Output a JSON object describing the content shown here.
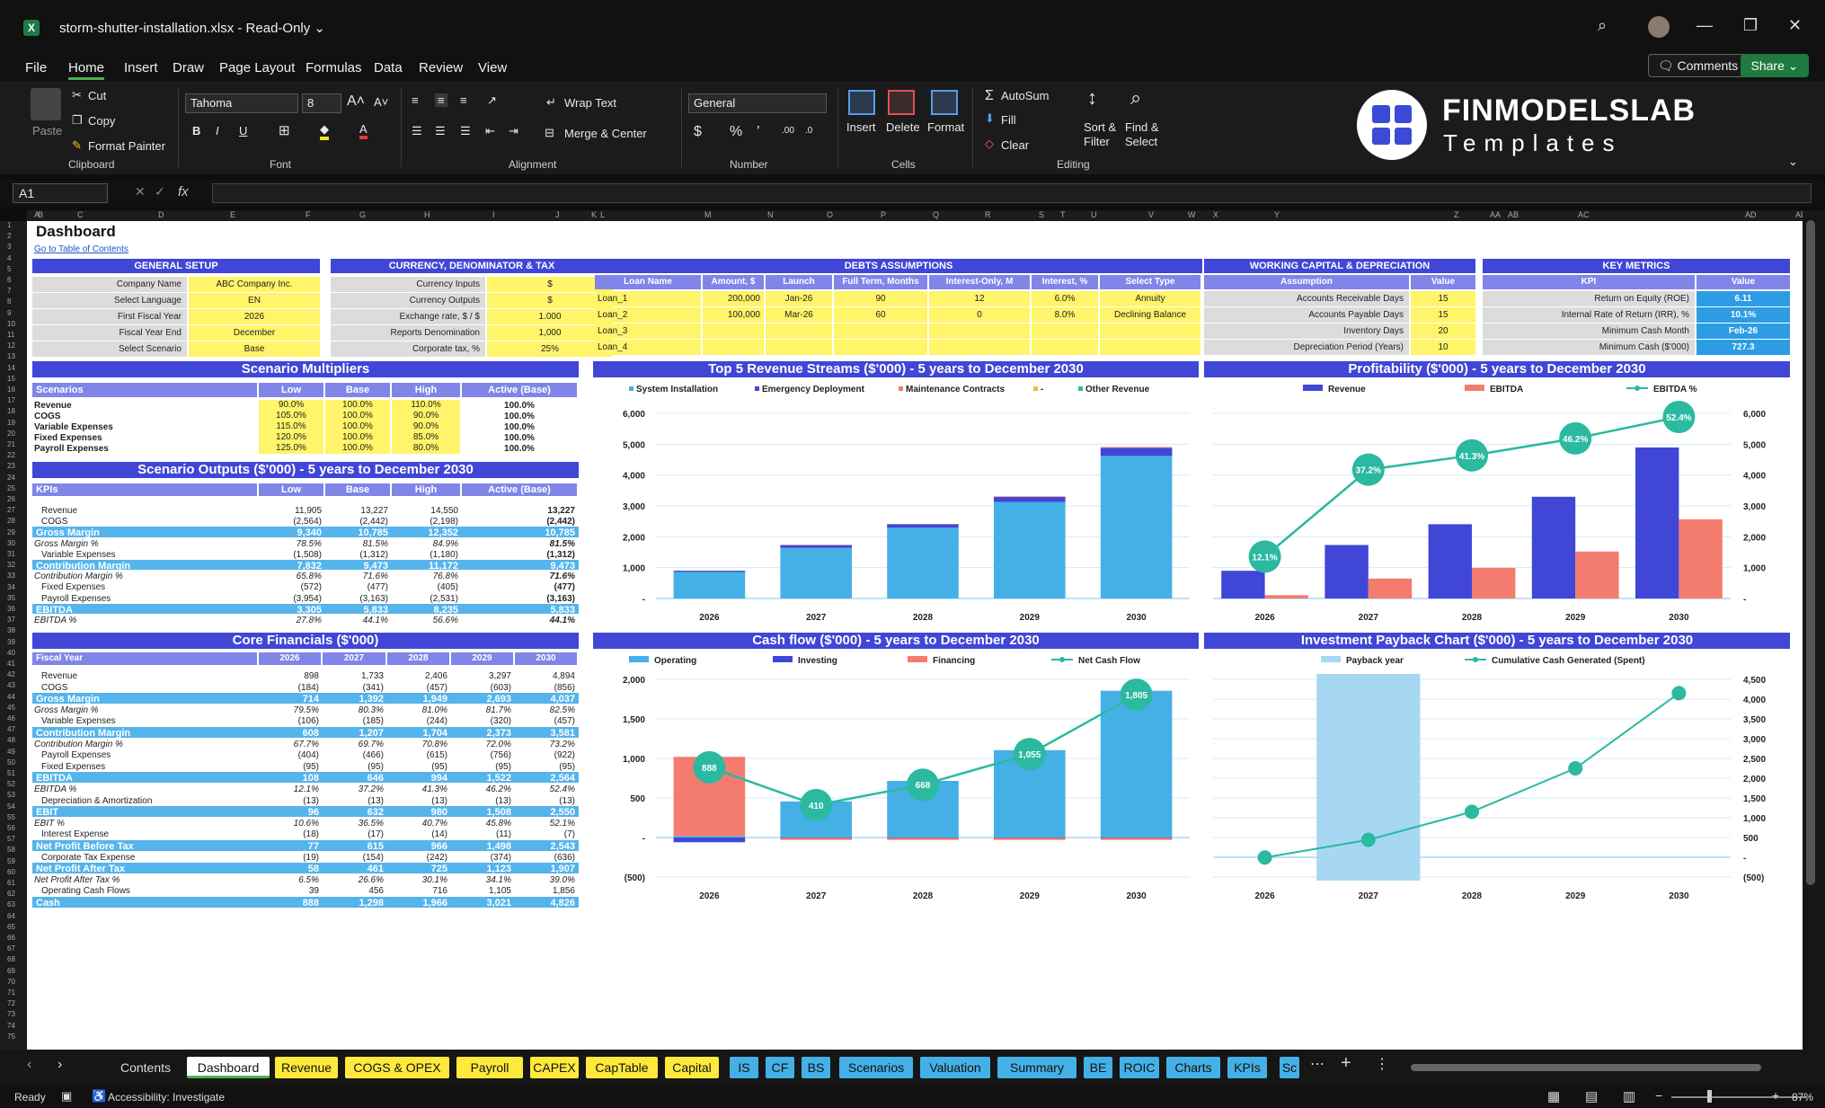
{
  "window": {
    "title": "storm-shutter-installation.xlsx  -  Read-Only ⌄",
    "app_icon": "X"
  },
  "menu": [
    "File",
    "Home",
    "Insert",
    "Draw",
    "Page Layout",
    "Formulas",
    "Data",
    "Review",
    "View"
  ],
  "menu_active": "Home",
  "buttons": {
    "comments": "🗨 Comments",
    "share": "Share ⌄"
  },
  "ribbon": {
    "paste": "Paste",
    "cut": "Cut",
    "copy": "Copy",
    "format_painter": "Format Painter",
    "font_name": "Tahoma",
    "font_size": "8",
    "wrap_text": "Wrap Text",
    "merge_center": "Merge & Center",
    "number_format": "General",
    "insert": "Insert",
    "delete": "Delete",
    "format": "Format",
    "autosum": "AutoSum",
    "fill": "Fill",
    "clear": "Clear",
    "sort_filter": "Sort & Filter",
    "find_select": "Find & Select",
    "groups": [
      "Clipboard",
      "Font",
      "Alignment",
      "Number",
      "Cells",
      "Editing"
    ]
  },
  "logo": {
    "line1": "FINMODELSLAB",
    "line2": "Templates"
  },
  "formula_bar": {
    "name_box": "A1",
    "fx": "fx"
  },
  "columns": [
    "A",
    "B",
    "C",
    "D",
    "E",
    "F",
    "G",
    "H",
    "I",
    "J",
    "K",
    "L",
    "M",
    "N",
    "O",
    "P",
    "Q",
    "R",
    "S",
    "T",
    "U",
    "V",
    "W",
    "X",
    "Y",
    "Z",
    "AA",
    "AB",
    "AC",
    "AD",
    "AE"
  ],
  "dashboard": {
    "title": "Dashboard",
    "link": "Go to Table of Contents",
    "general_setup": {
      "title": "GENERAL SETUP",
      "rows": [
        [
          "Company Name",
          "ABC Company Inc."
        ],
        [
          "Select Language",
          "EN"
        ],
        [
          "First Fiscal Year",
          "2026"
        ],
        [
          "Fiscal Year End",
          "December"
        ],
        [
          "Select Scenario",
          "Base"
        ]
      ]
    },
    "currency": {
      "title": "CURRENCY, DENOMINATOR & TAX",
      "rows": [
        [
          "Currency Inputs",
          "$"
        ],
        [
          "Currency Outputs",
          "$"
        ],
        [
          "Exchange rate, $ / $",
          "1.000"
        ],
        [
          "Reports Denomination",
          "1,000"
        ],
        [
          "Corporate tax, %",
          "25%"
        ]
      ]
    },
    "debts": {
      "title": "DEBTS ASSUMPTIONS",
      "headers": [
        "Loan Name",
        "Amount, $",
        "Launch",
        "Full Term, Months",
        "Interest-Only, M",
        "Interest, %",
        "Select Type"
      ],
      "rows": [
        [
          "Loan_1",
          "200,000",
          "Jan-26",
          "90",
          "12",
          "6.0%",
          "Annuity"
        ],
        [
          "Loan_2",
          "100,000",
          "Mar-26",
          "60",
          "0",
          "8.0%",
          "Declining Balance"
        ],
        [
          "Loan_3",
          "",
          "",
          "",
          "",
          "",
          ""
        ],
        [
          "Loan_4",
          "",
          "",
          "",
          "",
          "",
          ""
        ]
      ]
    },
    "working_capital": {
      "title": "WORKING CAPITAL & DEPRECIATION",
      "headers": [
        "Assumption",
        "Value"
      ],
      "rows": [
        [
          "Accounts Receivable Days",
          "15"
        ],
        [
          "Accounts Payable Days",
          "15"
        ],
        [
          "Inventory Days",
          "20"
        ],
        [
          "Depreciation Period (Years)",
          "10"
        ]
      ]
    },
    "key_metrics": {
      "title": "KEY METRICS",
      "headers": [
        "KPI",
        "Value"
      ],
      "rows": [
        [
          "Return on Equity (ROE)",
          "6.11"
        ],
        [
          "Internal Rate of Return (IRR), %",
          "10.1%"
        ],
        [
          "Minimum Cash Month",
          "Feb-26"
        ],
        [
          "Minimum Cash ($'000)",
          "727.3"
        ]
      ]
    },
    "scenario_multipliers": {
      "title": "Scenario Multipliers",
      "headers": [
        "Scenarios",
        "Low",
        "Base",
        "High",
        "Active (Base)"
      ],
      "rows": [
        [
          "Revenue",
          "90.0%",
          "100.0%",
          "110.0%",
          "100.0%"
        ],
        [
          "COGS",
          "105.0%",
          "100.0%",
          "90.0%",
          "100.0%"
        ],
        [
          "Variable Expenses",
          "115.0%",
          "100.0%",
          "90.0%",
          "100.0%"
        ],
        [
          "Fixed Expenses",
          "120.0%",
          "100.0%",
          "85.0%",
          "100.0%"
        ],
        [
          "Payroll Expenses",
          "125.0%",
          "100.0%",
          "80.0%",
          "100.0%"
        ]
      ]
    },
    "scenario_outputs": {
      "title": "Scenario Outputs ($'000) - 5 years to December 2030",
      "headers": [
        "KPIs",
        "Low",
        "Base",
        "High",
        "Active (Base)"
      ],
      "rows": [
        [
          "Revenue",
          "11,905",
          "13,227",
          "14,550",
          "13,227",
          "n"
        ],
        [
          "COGS",
          "(2,564)",
          "(2,442)",
          "(2,198)",
          "(2,442)",
          "n"
        ],
        [
          "Gross Margin",
          "9,340",
          "10,785",
          "12,352",
          "10,785",
          "b"
        ],
        [
          "Gross Margin %",
          "78.5%",
          "81.5%",
          "84.9%",
          "81.5%",
          "i"
        ],
        [
          "Variable Expenses",
          "(1,508)",
          "(1,312)",
          "(1,180)",
          "(1,312)",
          "n"
        ],
        [
          "Contribution Margin",
          "7,832",
          "9,473",
          "11,172",
          "9,473",
          "b"
        ],
        [
          "Contribution Margin %",
          "65.8%",
          "71.6%",
          "76.8%",
          "71.6%",
          "i"
        ],
        [
          "Fixed Expenses",
          "(572)",
          "(477)",
          "(405)",
          "(477)",
          "n"
        ],
        [
          "Payroll Expenses",
          "(3,954)",
          "(3,163)",
          "(2,531)",
          "(3,163)",
          "n"
        ],
        [
          "EBITDA",
          "3,305",
          "5,833",
          "8,235",
          "5,833",
          "b"
        ],
        [
          "EBITDA %",
          "27.8%",
          "44.1%",
          "56.6%",
          "44.1%",
          "i"
        ]
      ]
    },
    "core_financials": {
      "title": "Core Financials ($'000)",
      "headers": [
        "Fiscal Year",
        "2026",
        "2027",
        "2028",
        "2029",
        "2030"
      ],
      "rows": [
        [
          "Revenue",
          "898",
          "1,733",
          "2,406",
          "3,297",
          "4,894",
          "n"
        ],
        [
          "COGS",
          "(184)",
          "(341)",
          "(457)",
          "(603)",
          "(856)",
          "n"
        ],
        [
          "Gross Margin",
          "714",
          "1,392",
          "1,949",
          "2,693",
          "4,037",
          "b"
        ],
        [
          "Gross Margin %",
          "79.5%",
          "80.3%",
          "81.0%",
          "81.7%",
          "82.5%",
          "i"
        ],
        [
          "Variable Expenses",
          "(106)",
          "(185)",
          "(244)",
          "(320)",
          "(457)",
          "n"
        ],
        [
          "Contribution Margin",
          "608",
          "1,207",
          "1,704",
          "2,373",
          "3,581",
          "b"
        ],
        [
          "Contribution Margin %",
          "67.7%",
          "69.7%",
          "70.8%",
          "72.0%",
          "73.2%",
          "i"
        ],
        [
          "Payroll Expenses",
          "(404)",
          "(466)",
          "(615)",
          "(756)",
          "(922)",
          "n"
        ],
        [
          "Fixed Expenses",
          "(95)",
          "(95)",
          "(95)",
          "(95)",
          "(95)",
          "n"
        ],
        [
          "EBITDA",
          "108",
          "646",
          "994",
          "1,522",
          "2,564",
          "b"
        ],
        [
          "EBITDA %",
          "12.1%",
          "37.2%",
          "41.3%",
          "46.2%",
          "52.4%",
          "i"
        ],
        [
          "Depreciation & Amortization",
          "(13)",
          "(13)",
          "(13)",
          "(13)",
          "(13)",
          "n"
        ],
        [
          "EBIT",
          "96",
          "632",
          "980",
          "1,508",
          "2,550",
          "b"
        ],
        [
          "EBIT %",
          "10.6%",
          "36.5%",
          "40.7%",
          "45.8%",
          "52.1%",
          "i"
        ],
        [
          "Interest Expense",
          "(18)",
          "(17)",
          "(14)",
          "(11)",
          "(7)",
          "n"
        ],
        [
          "Net Profit Before Tax",
          "77",
          "615",
          "966",
          "1,498",
          "2,543",
          "b"
        ],
        [
          "Corporate Tax Expense",
          "(19)",
          "(154)",
          "(242)",
          "(374)",
          "(636)",
          "n"
        ],
        [
          "Net Profit After Tax",
          "58",
          "461",
          "725",
          "1,123",
          "1,907",
          "b"
        ],
        [
          "Net Profit After Tax %",
          "6.5%",
          "26.6%",
          "30.1%",
          "34.1%",
          "39.0%",
          "i"
        ],
        [
          "Operating Cash Flows",
          "39",
          "456",
          "716",
          "1,105",
          "1,856",
          "n"
        ],
        [
          "Cash",
          "888",
          "1,298",
          "1,966",
          "3,021",
          "4,826",
          "b"
        ]
      ]
    }
  },
  "chart_data": [
    {
      "type": "bar",
      "title": "Top 5 Revenue Streams ($'000) - 5 years to December 2030",
      "categories": [
        "2026",
        "2027",
        "2028",
        "2029",
        "2030"
      ],
      "series": [
        {
          "name": "System Installation",
          "values": [
            860,
            1640,
            2300,
            3130,
            4620
          ],
          "color": "#45b0e5"
        },
        {
          "name": "Emergency Deployment",
          "values": [
            40,
            90,
            105,
            160,
            260
          ],
          "color": "#4046d6"
        },
        {
          "name": "Maintenance Contracts",
          "values": [
            5,
            10,
            10,
            20,
            30
          ],
          "color": "#f47c6e"
        },
        {
          "name": "-",
          "values": [
            0,
            0,
            0,
            0,
            0
          ],
          "color": "#f2b84b"
        },
        {
          "name": "Other Revenue",
          "values": [
            0,
            0,
            0,
            0,
            0
          ],
          "color": "#2bb9a0"
        }
      ],
      "ylim": [
        0,
        6000
      ],
      "yticks": [
        "-",
        "1,000",
        "2,000",
        "3,000",
        "4,000",
        "5,000",
        "6,000"
      ],
      "legend": "top"
    },
    {
      "type": "bar",
      "title": "Profitability ($'000) - 5 years to December 2030",
      "categories": [
        "2026",
        "2027",
        "2028",
        "2029",
        "2030"
      ],
      "series": [
        {
          "name": "Revenue",
          "values": [
            898,
            1733,
            2406,
            3297,
            4894
          ],
          "color": "#4046d6"
        },
        {
          "name": "EBITDA",
          "values": [
            108,
            646,
            994,
            1522,
            2564
          ],
          "color": "#f47c6e"
        },
        {
          "name": "EBITDA %",
          "values": [
            12.1,
            37.2,
            41.3,
            46.2,
            52.4
          ],
          "labels": [
            "12.1%",
            "37.2%",
            "41.3%",
            "46.2%",
            "52.4%"
          ],
          "color": "#2bb9a0"
        }
      ],
      "ylim": [
        0,
        6000
      ],
      "yticks": [
        "-",
        "1,000",
        "2,000",
        "3,000",
        "4,000",
        "5,000",
        "6,000"
      ],
      "legend": "top"
    },
    {
      "type": "bar",
      "title": "Cash flow ($'000) - 5 years to December 2030",
      "categories": [
        "2026",
        "2027",
        "2028",
        "2029",
        "2030"
      ],
      "series": [
        {
          "name": "Operating",
          "values": [
            20,
            456,
            716,
            1105,
            1856
          ],
          "color": "#45b0e5"
        },
        {
          "name": "Investing",
          "values": [
            -60,
            -5,
            -5,
            -5,
            -5
          ],
          "color": "#4046d6"
        },
        {
          "name": "Financing",
          "values": [
            1000,
            -25,
            -25,
            -25,
            -25
          ],
          "color": "#f47c6e"
        },
        {
          "name": "Net Cash Flow",
          "values": [
            888,
            410,
            668,
            1055,
            1805
          ],
          "labels": [
            "888",
            "410",
            "668",
            "1,055",
            "1,805"
          ],
          "color": "#2bb9a0"
        }
      ],
      "ylim": [
        -500,
        2000
      ],
      "yticks": [
        "(500)",
        "-",
        "500",
        "1,000",
        "1,500",
        "2,000"
      ],
      "legend": "top"
    },
    {
      "type": "line",
      "title": "Investment Payback Chart ($'000) - 5 years to December 2030",
      "categories": [
        "2026",
        "2027",
        "2028",
        "2029",
        "2030"
      ],
      "series": [
        {
          "name": "Payback year",
          "values": [
            0,
            1,
            0,
            0,
            0
          ],
          "color": "#a7d8f3"
        },
        {
          "name": "Cumulative Cash Generated (Spent)",
          "values": [
            -5,
            440,
            1150,
            2250,
            4150
          ],
          "color": "#2bb9a0"
        }
      ],
      "ylim": [
        -500,
        4500
      ],
      "yticks": [
        "(500)",
        "-",
        "500",
        "1,000",
        "1,500",
        "2,000",
        "2,500",
        "3,000",
        "3,500",
        "4,000",
        "4,500"
      ],
      "legend": "top"
    }
  ],
  "sheet_tabs": [
    {
      "name": "Contents",
      "color": "none"
    },
    {
      "name": "Dashboard",
      "color": "active"
    },
    {
      "name": "Revenue",
      "color": "#ffe93c"
    },
    {
      "name": "COGS & OPEX",
      "color": "#ffe93c"
    },
    {
      "name": "Payroll",
      "color": "#ffe93c"
    },
    {
      "name": "CAPEX",
      "color": "#ffe93c"
    },
    {
      "name": "CapTable",
      "color": "#ffe93c"
    },
    {
      "name": "Capital",
      "color": "#ffe93c"
    },
    {
      "name": "IS",
      "color": "#45b0e5"
    },
    {
      "name": "CF",
      "color": "#45b0e5"
    },
    {
      "name": "BS",
      "color": "#45b0e5"
    },
    {
      "name": "Scenarios",
      "color": "#45b0e5"
    },
    {
      "name": "Valuation",
      "color": "#45b0e5"
    },
    {
      "name": "Summary",
      "color": "#45b0e5"
    },
    {
      "name": "BE",
      "color": "#45b0e5"
    },
    {
      "name": "ROIC",
      "color": "#45b0e5"
    },
    {
      "name": "Charts",
      "color": "#45b0e5"
    },
    {
      "name": "KPIs",
      "color": "#45b0e5"
    },
    {
      "name": "Sc",
      "color": "#45b0e5"
    }
  ],
  "status_bar": {
    "ready": "Ready",
    "accessibility": "Accessibility: Investigate",
    "zoom": "87%"
  }
}
